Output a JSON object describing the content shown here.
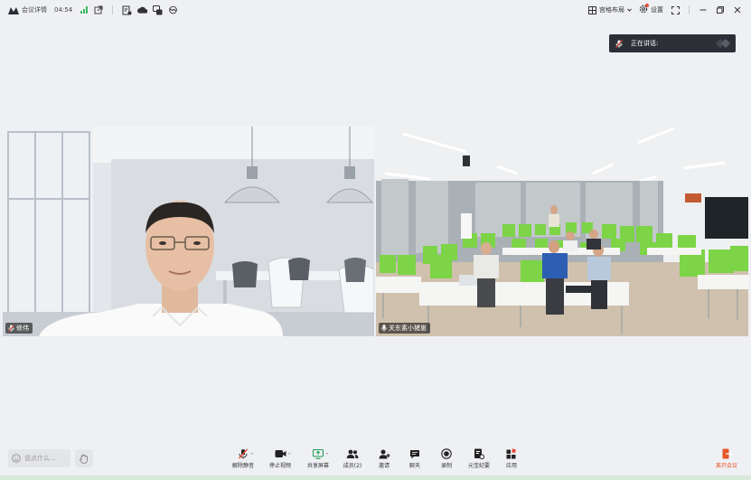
{
  "topbar": {
    "meeting_details": "会议详情",
    "timer": "04:54",
    "layout_label": "宫格布局",
    "settings_label": "设置"
  },
  "speaking": {
    "label": "正在讲话:"
  },
  "tiles": [
    {
      "name": "修伟"
    },
    {
      "name": "关东素小猪崽"
    }
  ],
  "chat": {
    "placeholder": "说点什么..."
  },
  "toolbar": {
    "unmute": "解除静音",
    "stop_video": "停止视频",
    "share_screen": "共享屏幕",
    "members": "成员(2)",
    "invite": "邀请",
    "chat": "聊天",
    "record": "录制",
    "minutes": "元宝纪要",
    "apps": "应用",
    "leave": "离开会议"
  },
  "colors": {
    "accent_green": "#3cb95e",
    "leave_orange": "#e8542a",
    "badge_red": "#e84b3c"
  }
}
